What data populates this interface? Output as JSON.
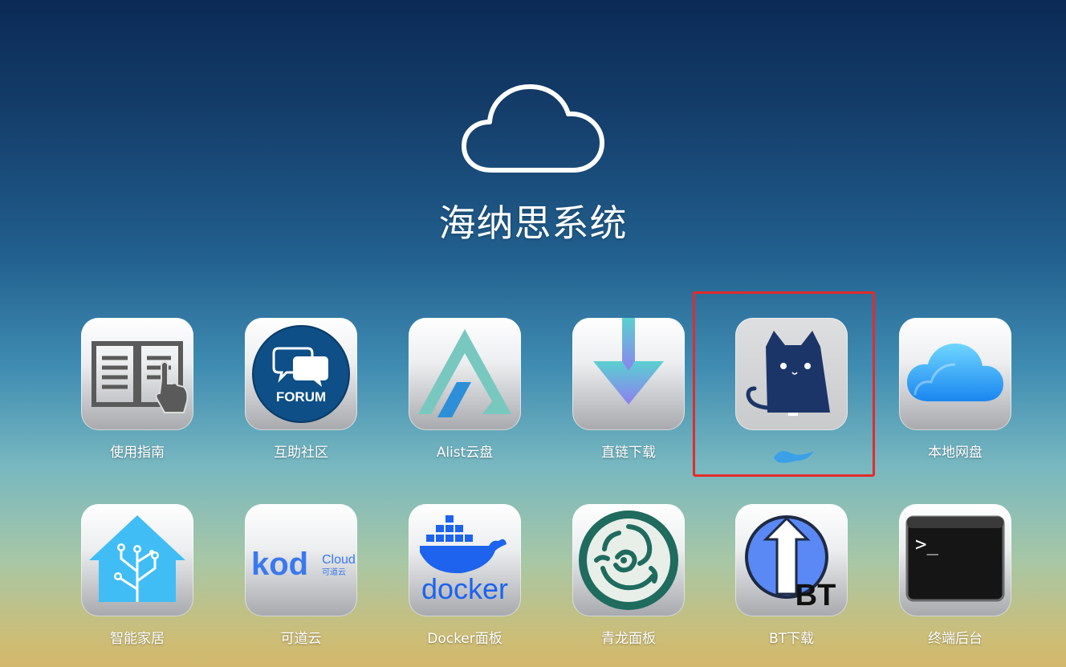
{
  "header": {
    "logo_icon": "cloud-outline-icon",
    "title": "海纳思系统"
  },
  "apps": [
    {
      "label": "使用指南",
      "icon": "book-hand-icon"
    },
    {
      "label": "互助社区",
      "icon": "forum-icon",
      "icon_text": "FORUM"
    },
    {
      "label": "Alist云盘",
      "icon": "alist-icon"
    },
    {
      "label": "直链下载",
      "icon": "download-arrow-icon"
    },
    {
      "label": "",
      "icon": "cat-icon"
    },
    {
      "label": "本地网盘",
      "icon": "icloud-icon"
    },
    {
      "label": "智能家居",
      "icon": "home-assistant-icon"
    },
    {
      "label": "可道云",
      "icon": "kodcloud-icon",
      "icon_text_main": "kod",
      "icon_text_brand": "Cloud",
      "icon_text_sub": "可道云"
    },
    {
      "label": "Docker面板",
      "icon": "docker-icon",
      "icon_text": "docker"
    },
    {
      "label": "青龙面板",
      "icon": "qinglong-dragon-icon"
    },
    {
      "label": "BT下载",
      "icon": "bt-download-icon",
      "icon_text": "BT"
    },
    {
      "label": "终端后台",
      "icon": "terminal-icon",
      "icon_text": ">_"
    }
  ],
  "colors": {
    "highlight": "#e52a2a",
    "redaction": "#3aa0e8"
  }
}
